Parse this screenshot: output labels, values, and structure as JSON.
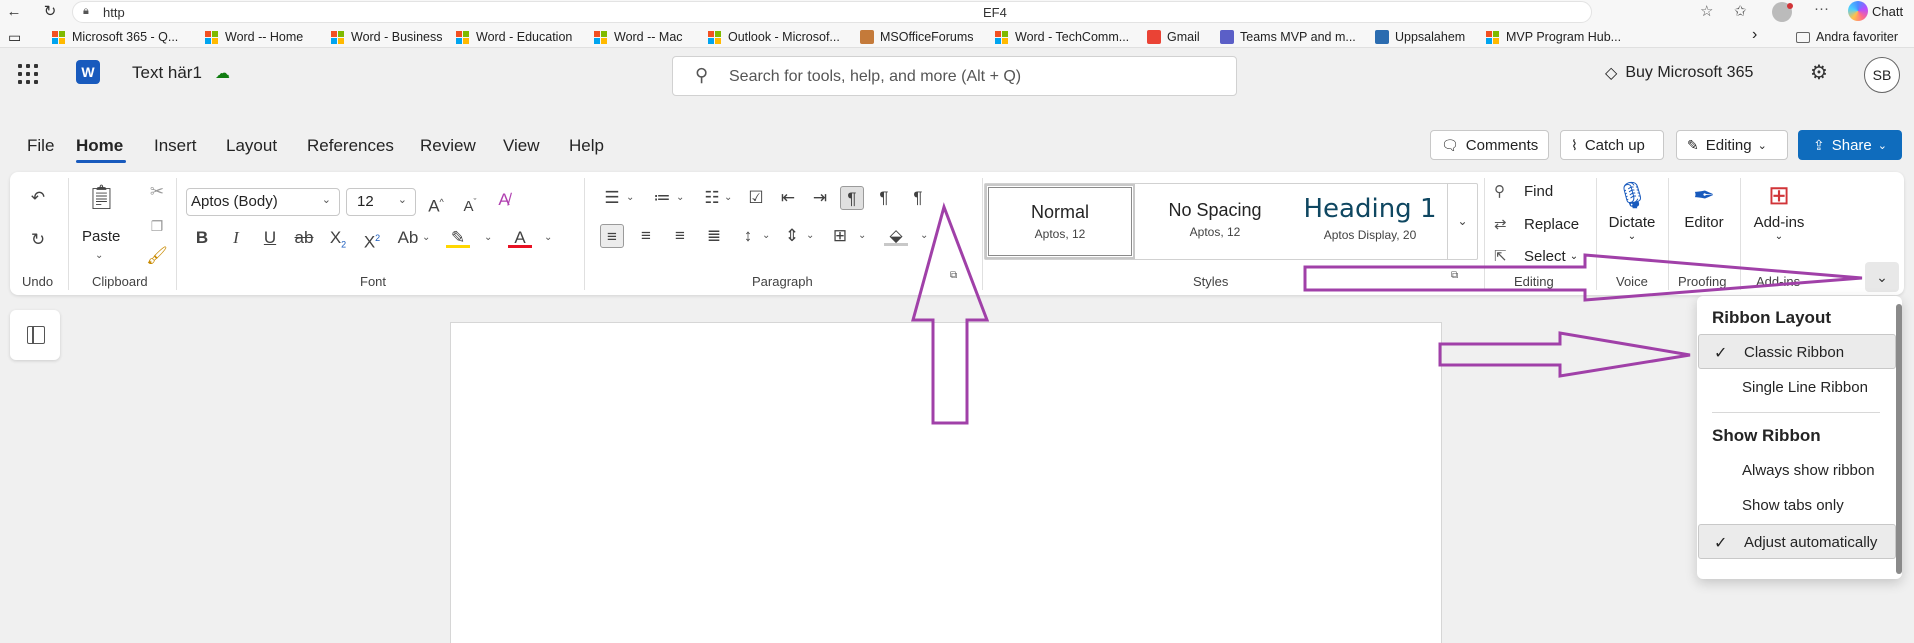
{
  "browser": {
    "url": "http",
    "tab_title": "EF4",
    "profile_label": "Chatt",
    "favorites": [
      {
        "label": "Microsoft 365 - Q...",
        "icon": "ms-logo"
      },
      {
        "label": "Word -- Home",
        "icon": "ms-logo"
      },
      {
        "label": "Word - Business",
        "icon": "ms-logo"
      },
      {
        "label": "Word - Education",
        "icon": "ms-logo"
      },
      {
        "label": "Word -- Mac",
        "icon": "ms-logo"
      },
      {
        "label": "Outlook - Microsof...",
        "icon": "ms-logo"
      },
      {
        "label": "MSOfficeForums",
        "icon": "forum-icon"
      },
      {
        "label": "Word - TechComm...",
        "icon": "ms-logo"
      },
      {
        "label": "Gmail",
        "icon": "gmail-icon"
      },
      {
        "label": "Teams MVP and m...",
        "icon": "teams-icon"
      },
      {
        "label": "Uppsalahem",
        "icon": "uppsalahem-icon"
      },
      {
        "label": "MVP Program Hub...",
        "icon": "ms-logo"
      }
    ],
    "other_favorites": "Andra favoriter"
  },
  "app": {
    "doc_title": "Text här1",
    "search_placeholder": "Search for tools, help, and more (Alt + Q)",
    "buy_label": "Buy Microsoft 365",
    "avatar_initials": "SB"
  },
  "tabs": [
    {
      "label": "File",
      "active": false
    },
    {
      "label": "Home",
      "active": true
    },
    {
      "label": "Insert",
      "active": false
    },
    {
      "label": "Layout",
      "active": false
    },
    {
      "label": "References",
      "active": false
    },
    {
      "label": "Review",
      "active": false
    },
    {
      "label": "View",
      "active": false
    },
    {
      "label": "Help",
      "active": false
    }
  ],
  "actions": {
    "comments": "Comments",
    "catchup": "Catch up",
    "editing": "Editing",
    "share": "Share"
  },
  "ribbon": {
    "undo_label": "Undo",
    "clipboard": {
      "paste": "Paste",
      "label": "Clipboard"
    },
    "font": {
      "name": "Aptos (Body)",
      "size": "12",
      "label": "Font"
    },
    "paragraph_label": "Paragraph",
    "styles": {
      "label": "Styles",
      "items": [
        {
          "name": "Normal",
          "sub": "Aptos, 12"
        },
        {
          "name": "No Spacing",
          "sub": "Aptos, 12"
        },
        {
          "name": "Heading 1",
          "sub": "Aptos Display, 20"
        }
      ]
    },
    "editing": {
      "find": "Find",
      "replace": "Replace",
      "select": "Select",
      "label": "Editing"
    },
    "voice": {
      "dictate": "Dictate",
      "label": "Voice"
    },
    "proofing": {
      "editor": "Editor",
      "label": "Proofing"
    },
    "addins": {
      "button": "Add-ins",
      "label": "Add-ins"
    }
  },
  "ribbon_menu": {
    "layout_heading": "Ribbon Layout",
    "layout_options": [
      {
        "label": "Classic Ribbon",
        "checked": true
      },
      {
        "label": "Single Line Ribbon",
        "checked": false
      }
    ],
    "show_heading": "Show Ribbon",
    "show_options": [
      {
        "label": "Always show ribbon",
        "checked": false
      },
      {
        "label": "Show tabs only",
        "checked": false
      },
      {
        "label": "Adjust automatically",
        "checked": true
      }
    ]
  },
  "colors": {
    "accent": "#185abd",
    "share": "#0f6cbd",
    "annotation": "#a040a8",
    "font_color": "#e81123"
  }
}
